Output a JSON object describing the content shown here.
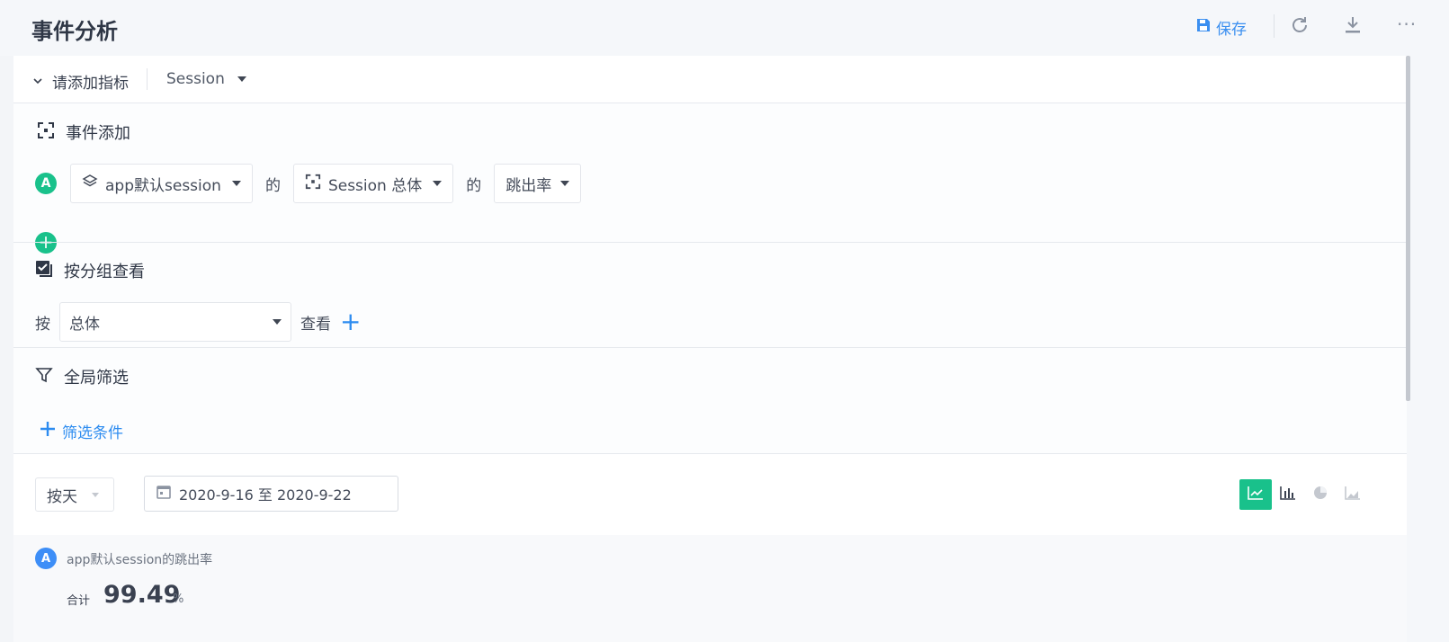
{
  "header": {
    "title": "事件分析",
    "save_label": "保存",
    "icons": [
      "save-icon",
      "refresh-icon",
      "download-icon",
      "more-icon"
    ],
    "more_label": "···"
  },
  "indicator": {
    "label": "请添加指标",
    "session_select": "Session"
  },
  "event_section": {
    "title": "事件添加",
    "badge": "A",
    "event_select": "app默认session",
    "de1": "的",
    "property_select": "Session 总体",
    "de2": "的",
    "metric_select": "跳出率",
    "add_symbol": "+"
  },
  "group_section": {
    "title": "按分组查看",
    "by_label": "按",
    "group_select": "总体",
    "view_label": "查看",
    "add_symbol": "+"
  },
  "filter_section": {
    "title": "全局筛选",
    "add_label": "筛选条件"
  },
  "controls": {
    "granularity": "按天",
    "date_range": "2020-9-16 至 2020-9-22",
    "chart_types": [
      "line-chart",
      "bar-chart",
      "pie-chart",
      "area-chart"
    ],
    "active_chart_type": "line-chart"
  },
  "result": {
    "badge": "A",
    "metric_name": "app默认session的跳出率",
    "total_label": "合计",
    "total_value": "99.49",
    "total_unit": "%"
  },
  "colors": {
    "accent_green": "#19c18b",
    "accent_blue": "#2d8cf0",
    "badge_blue": "#3d8ef7"
  }
}
